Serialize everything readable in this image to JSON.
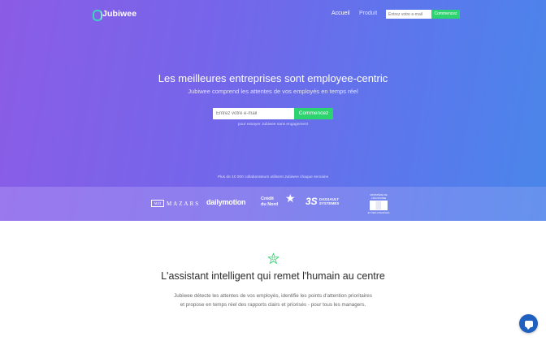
{
  "header": {
    "logo_text": "Jubiwee",
    "nav": [
      {
        "label": "Accueil",
        "active": true
      },
      {
        "label": "Produit",
        "active": false
      }
    ],
    "email_placeholder": "Entrez votre e-mail",
    "cta_label": "Commencez"
  },
  "hero": {
    "title": "Les meilleures entreprises sont employee-centric",
    "subtitle": "Jubiwee comprend les attentes de vos employés en temps réel",
    "email_placeholder": "Entrez votre e-mail",
    "cta_label": "Commencez",
    "note": "pour essayer Jubiwee sans engagement",
    "count_text": "Plus de 10 000 collaborateurs utilisent Jubiwee chaque semaine"
  },
  "clients": {
    "mazars_box": "M/ZI",
    "mazars": "MAZARS",
    "dailymotion": "dailymotion",
    "credit_line1": "Crédit",
    "credit_line2": "du Nord",
    "dassault_mark": "3S",
    "dassault_line1": "DASSAULT",
    "dassault_line2": "SYSTEMES",
    "ministry_top": "MINISTÈRE DE L'ÉCONOMIE",
    "ministry_bottom": "ET DES FINANCES"
  },
  "section": {
    "title": "L'assistant intelligent qui remet l'humain au centre",
    "body": "Jubiwee détecte les attentes de vos employés, identifie les points d'attention prioritaires et propose en temps réel des rapports clairs et priorisés - pour tous les managers."
  },
  "colors": {
    "accent_green": "#2dd36f",
    "hero_start": "#8b5ce6",
    "hero_end": "#4a86ea",
    "chat_blue": "#1f5fbf"
  },
  "icons": {
    "logo": "jubiwee-logo-icon",
    "section": "sparkle-star-icon",
    "chat": "chat-bubble-icon"
  }
}
